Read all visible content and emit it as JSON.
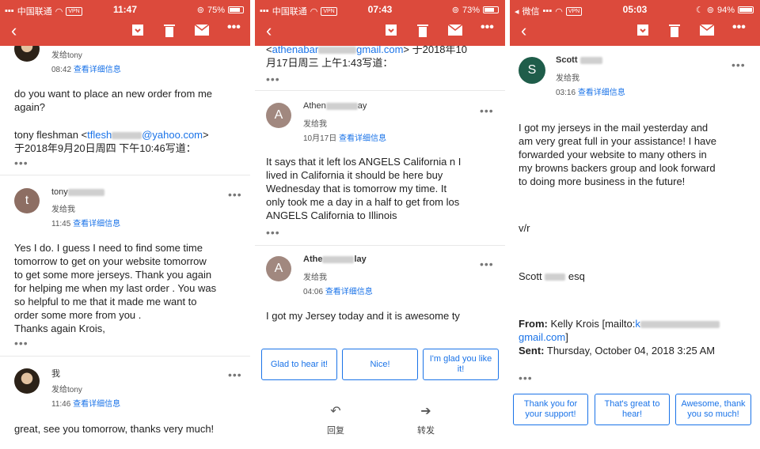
{
  "panels": [
    {
      "status": {
        "carrier": "中国联通",
        "vpn": "VPN",
        "time": "11:47",
        "battery": "75%"
      },
      "messages": [
        {
          "sent_to": "发给tony",
          "time": "08:42",
          "details": "查看详细信息",
          "body": [
            "do you want to place an new order from me",
            "again?"
          ],
          "quote_name": "tony fleshman <",
          "quote_link": "tflesh",
          "quote_domain": "@yahoo.com",
          "quote_end": ">",
          "quote_date": "于2018年9月20日周四 下午10:46写道："
        },
        {
          "avatar_letter": "t",
          "avatar_color": "#8d6e63",
          "sender": "tony",
          "sent_to": "发给我",
          "time": "11:45",
          "details": "查看详细信息",
          "body": [
            "Yes I do. I guess I need to find some time",
            "tomorrow to get on your website tomorrow",
            "to get some more jerseys. Thank you again",
            "for helping me when my last order . You was",
            "so helpful to me that it made me want to",
            "order some more from you .",
            "Thanks again Krois,"
          ]
        },
        {
          "sender": "我",
          "sent_to": "发给tony",
          "time": "11:46",
          "details": "查看详细信息",
          "body": [
            "great, see you tomorrow, thanks very much!"
          ]
        }
      ]
    },
    {
      "status": {
        "carrier": "中国联通",
        "vpn": "VPN",
        "time": "07:43",
        "battery": "73%"
      },
      "top_quote_link": "athenabar",
      "top_quote_domain": "gmail.com",
      "top_quote_rest": "> 于2018年10",
      "top_quote_line2": "月17日周三 上午1:43写道：",
      "messages": [
        {
          "avatar_letter": "A",
          "avatar_color": "#a1887f",
          "sender": "Athen",
          "sender_tail": "ay",
          "sent_to": "发给我",
          "time": "10月17日",
          "details": "查看详细信息",
          "body": [
            "It says that it left los ANGELS California n I",
            "lived in California it should be here buy",
            "Wednesday that is tomorrow my time.  It",
            "only took me a  day in a half to get from los",
            "ANGELS California to Illinois"
          ]
        },
        {
          "avatar_letter": "A",
          "avatar_color": "#a1887f",
          "sender": "Athe",
          "sender_tail": "lay",
          "sent_to": "发给我",
          "time": "04:06",
          "details": "查看详细信息",
          "body": [
            "I got my Jersey today and it is awesome ty"
          ]
        }
      ],
      "smart_replies": [
        "Glad to hear it!",
        "Nice!",
        "I'm glad you like it!"
      ],
      "actions": {
        "reply": "回复",
        "forward": "转发"
      }
    },
    {
      "status": {
        "carrier": "微信",
        "vpn": "VPN",
        "time": "05:03",
        "battery": "94%"
      },
      "messages": [
        {
          "avatar_letter": "S",
          "avatar_color": "#1f5d4a",
          "sender": "Scott",
          "sent_to": "发给我",
          "time": "03:16",
          "details": "查看详细信息",
          "body": [
            "I got my jerseys in the mail yesterday and",
            "am very great full in your assistance!  I have",
            "forwarded your website to many others in",
            "my browns backers group and look forward",
            "to doing more business in the future!"
          ],
          "vr": "v/r",
          "sign_first": "Scott",
          "sign_last": "esq",
          "from_label": "From:",
          "from_value": "Kelly Krois [mailto:",
          "from_link_start": "k",
          "from_link_end": "gmail.com",
          "from_bracket": "]",
          "sent_label": "Sent:",
          "sent_value": "Thursday, October 04, 2018 3:25 AM"
        }
      ],
      "smart_replies": [
        "Thank you for your support!",
        "That's great to hear!",
        "Awesome, thank you so much!"
      ]
    }
  ],
  "colors": {
    "topbar": "#dc4a3c",
    "link": "#1a73e8"
  },
  "icons": [
    "back-arrow-icon",
    "archive-icon",
    "delete-icon",
    "mail-icon",
    "more-icon"
  ]
}
